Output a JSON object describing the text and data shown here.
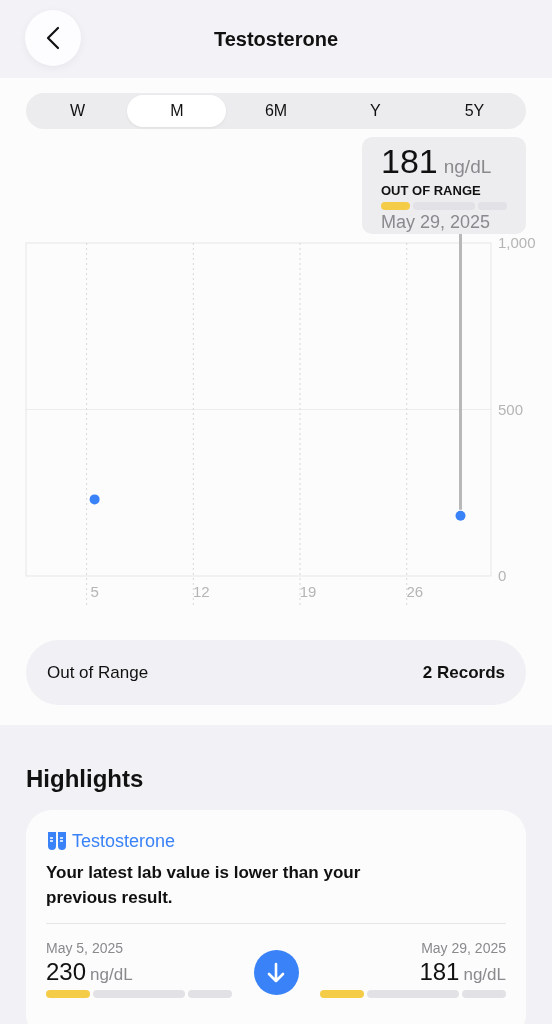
{
  "header": {
    "title": "Testosterone"
  },
  "periods": [
    {
      "label": "W",
      "selected": false
    },
    {
      "label": "M",
      "selected": true
    },
    {
      "label": "6M",
      "selected": false
    },
    {
      "label": "Y",
      "selected": false
    },
    {
      "label": "5Y",
      "selected": false
    }
  ],
  "tooltip": {
    "value": "181",
    "unit": "ng/dL",
    "status_label": "OUT OF RANGE",
    "date": "May 29, 2025"
  },
  "chart_data": {
    "type": "scatter",
    "x": [
      5,
      29
    ],
    "series": [
      {
        "color": "#3a82f7",
        "values": [
          230,
          181
        ]
      }
    ],
    "xlim": [
      0.5,
      31
    ],
    "ylim": [
      0,
      1000
    ],
    "xticks": [
      5,
      12,
      19,
      26
    ],
    "yticks": [
      0,
      500,
      {
        "value": 1000,
        "label": "1,000"
      }
    ]
  },
  "summary": {
    "label": "Out of Range",
    "count": "2 Records"
  },
  "highlights": {
    "heading": "Highlights",
    "card": {
      "title": "Testosterone",
      "text": "Your latest lab value is lower than your previous result.",
      "readings": [
        {
          "date": "May 5, 2025",
          "value": "230",
          "unit": "ng/dL"
        },
        {
          "date": "May 29, 2025",
          "value": "181",
          "unit": "ng/dL"
        }
      ]
    }
  }
}
